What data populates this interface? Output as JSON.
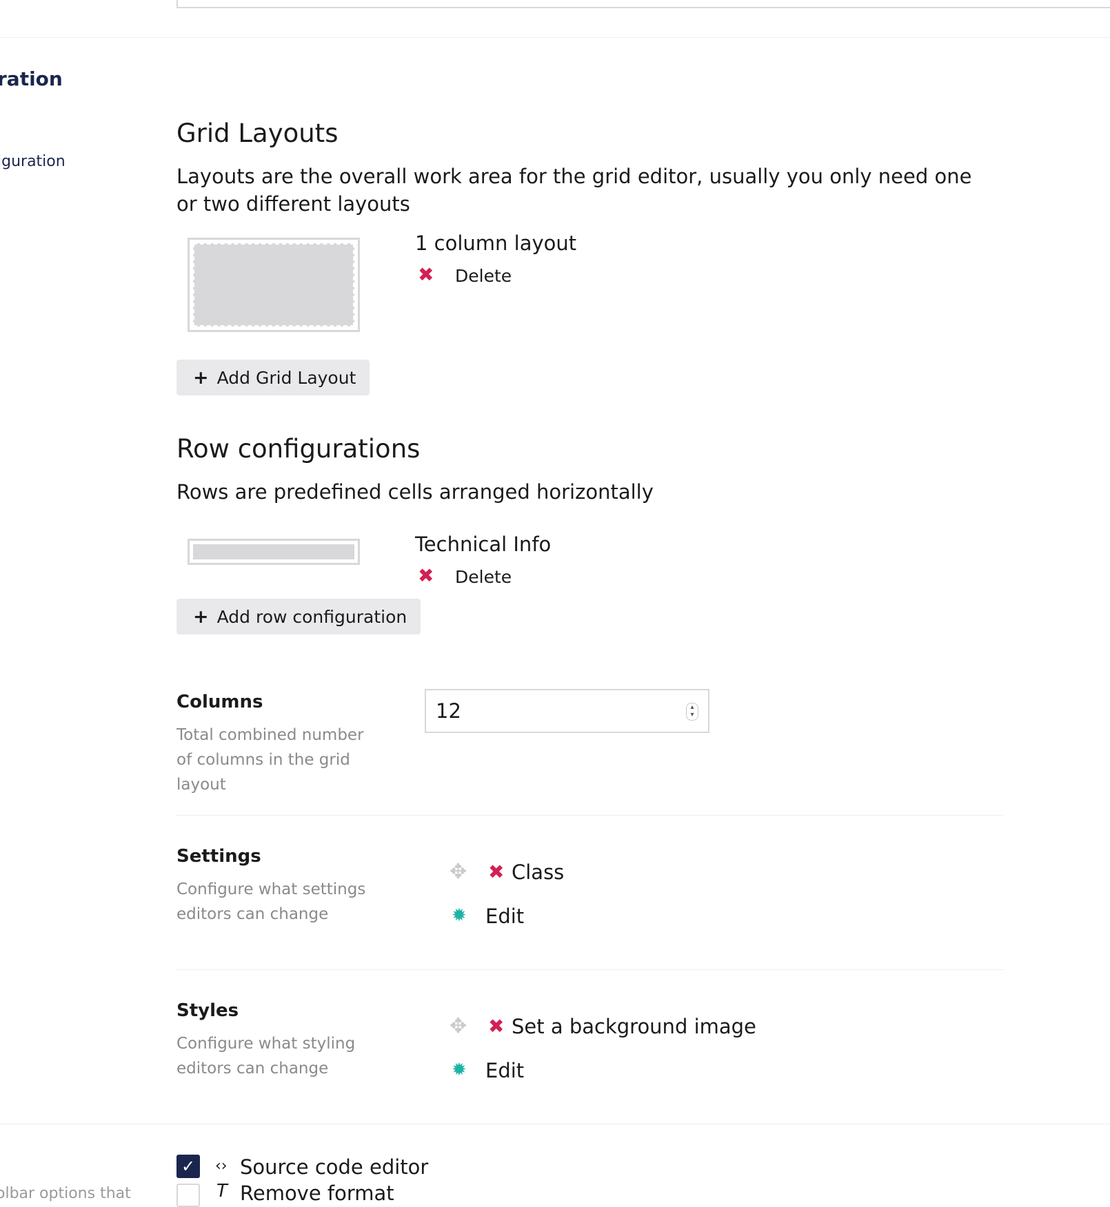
{
  "sidebar": {
    "heading": "ration",
    "subitem": "iguration",
    "bottom_text": "olbar options that"
  },
  "grid_layouts": {
    "title": "Grid Layouts",
    "description": "Layouts are the overall work area for the grid editor, usually you only need one or two different layouts",
    "items": [
      {
        "name": "1 column layout",
        "delete_label": "Delete"
      }
    ],
    "add_button": "Add Grid Layout"
  },
  "row_configurations": {
    "title": "Row configurations",
    "description": "Rows are predefined cells arranged horizontally",
    "items": [
      {
        "name": "Technical Info",
        "delete_label": "Delete"
      }
    ],
    "add_button": "Add row configuration"
  },
  "columns": {
    "label": "Columns",
    "description": "Total combined number of columns in the grid layout",
    "value": "12"
  },
  "settings": {
    "label": "Settings",
    "description": "Configure what settings editors can change",
    "items": [
      "Class"
    ],
    "edit_label": "Edit"
  },
  "styles": {
    "label": "Styles",
    "description": "Configure what styling editors can change",
    "items": [
      "Set a background image"
    ],
    "edit_label": "Edit"
  },
  "toolbar_options": [
    {
      "label": "Source code editor",
      "checked": true,
      "icon": "code-icon"
    },
    {
      "label": "Remove format",
      "checked": false,
      "icon": "remove-format-icon"
    }
  ],
  "icons": {
    "delete": "✖",
    "plus": "+",
    "move": "✥",
    "gear": "✹",
    "check": "✓"
  },
  "colors": {
    "delete_red": "#d42054",
    "gear_teal": "#1fb2a6",
    "checkbox_navy": "#1b264f",
    "button_bg": "#e9e9eb"
  }
}
